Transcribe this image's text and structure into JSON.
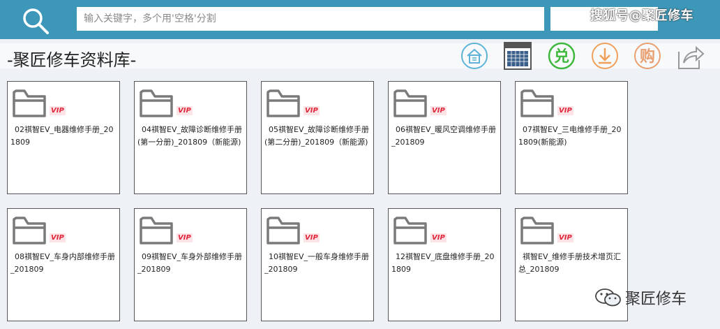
{
  "search": {
    "placeholder": "输入关键字，多个用'空格'分割",
    "button_label": ""
  },
  "watermark_top": "搜狐号@聚匠修车",
  "page_title": "-聚匠修车资料库-",
  "toolbar": {
    "icons": [
      "home-icon",
      "calendar-icon",
      "exchange-icon",
      "download-icon",
      "buy-icon",
      "share-icon"
    ],
    "exchange_char": "兑",
    "buy_char": "购",
    "colors": {
      "home": "#5fb3d6",
      "exchange": "#3db83d",
      "download": "#f0a05a",
      "buy": "#e8a070",
      "share": "#999999",
      "calendar": "#3a5f8a"
    }
  },
  "badge": "VIP",
  "folders": [
    "02祺智EV_电器维修手册_201809",
    "04祺智EV_故障诊断维修手册(第一分册)_201809（新能源)",
    "05祺智EV_故障诊断维修手册(第二分册)_201809（新能源)",
    "06祺智EV_暖风空调维修手册_201809",
    "07祺智EV_三电维修手册_201809(新能源)",
    "08祺智EV_车身内部维修手册_201809",
    "09祺智EV_车身外部维修手册_201809",
    "10祺智EV_一般车身维修手册_201809",
    "12祺智EV_底盘维修手册_201809",
    "祺智EV_维修手册技术增页汇总_201809"
  ],
  "watermark_bottom": "聚匠修车",
  "colors": {
    "topbar": "#3d97b9",
    "page_bg": "#eef2f7",
    "vip": "#e0283c"
  }
}
